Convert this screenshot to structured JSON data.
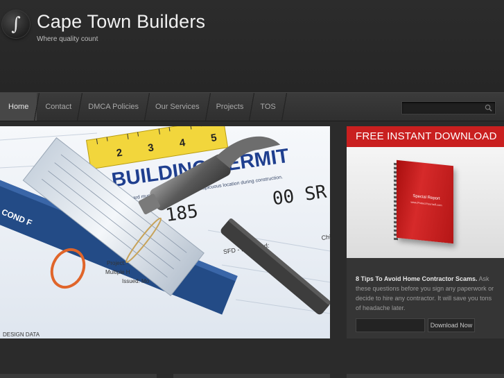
{
  "site": {
    "title": "Cape Town Builders",
    "tagline": "Where quality count",
    "logo_glyph": "∫"
  },
  "nav": {
    "items": [
      {
        "label": "Home",
        "active": true
      },
      {
        "label": "Contact",
        "active": false
      },
      {
        "label": "DMCA Policies",
        "active": false
      },
      {
        "label": "Our Services",
        "active": false
      },
      {
        "label": "Projects",
        "active": false
      },
      {
        "label": "TOS",
        "active": false
      }
    ],
    "search_value": "",
    "search_icon": "search-icon"
  },
  "hero": {
    "permit_heading": "BUILDING PERMIT",
    "permit_line": "This card must be kept posted in a conspicuous location during construction.",
    "number_left": "185",
    "number_right": "00 SR",
    "detail_1": "Project:",
    "detail_2": "Multiple H",
    "detail_3": "Issued: Mo",
    "detail_4": "SFD - Detached:",
    "detail_5": "Chief",
    "plan_label": "COND F",
    "plan_label_2": "DESIGN DATA",
    "tape_numbers": [
      "2",
      "3",
      "4",
      "5"
    ]
  },
  "sidebar": {
    "banner": "FREE INSTANT DOWNLOAD",
    "book_title": "Special Report",
    "book_sub": "www.ProtectYourself.com",
    "promo_bold": "8 Tips To Avoid Home Contractor Scams.",
    "promo_text": " Ask these questions before you sign any paperwork or decide to hire any contractor. It will save you tons of headache later.",
    "email_value": "",
    "button_label": "Download Now"
  },
  "colors": {
    "accent_red": "#c91f1f",
    "background": "#2b2b2b"
  }
}
